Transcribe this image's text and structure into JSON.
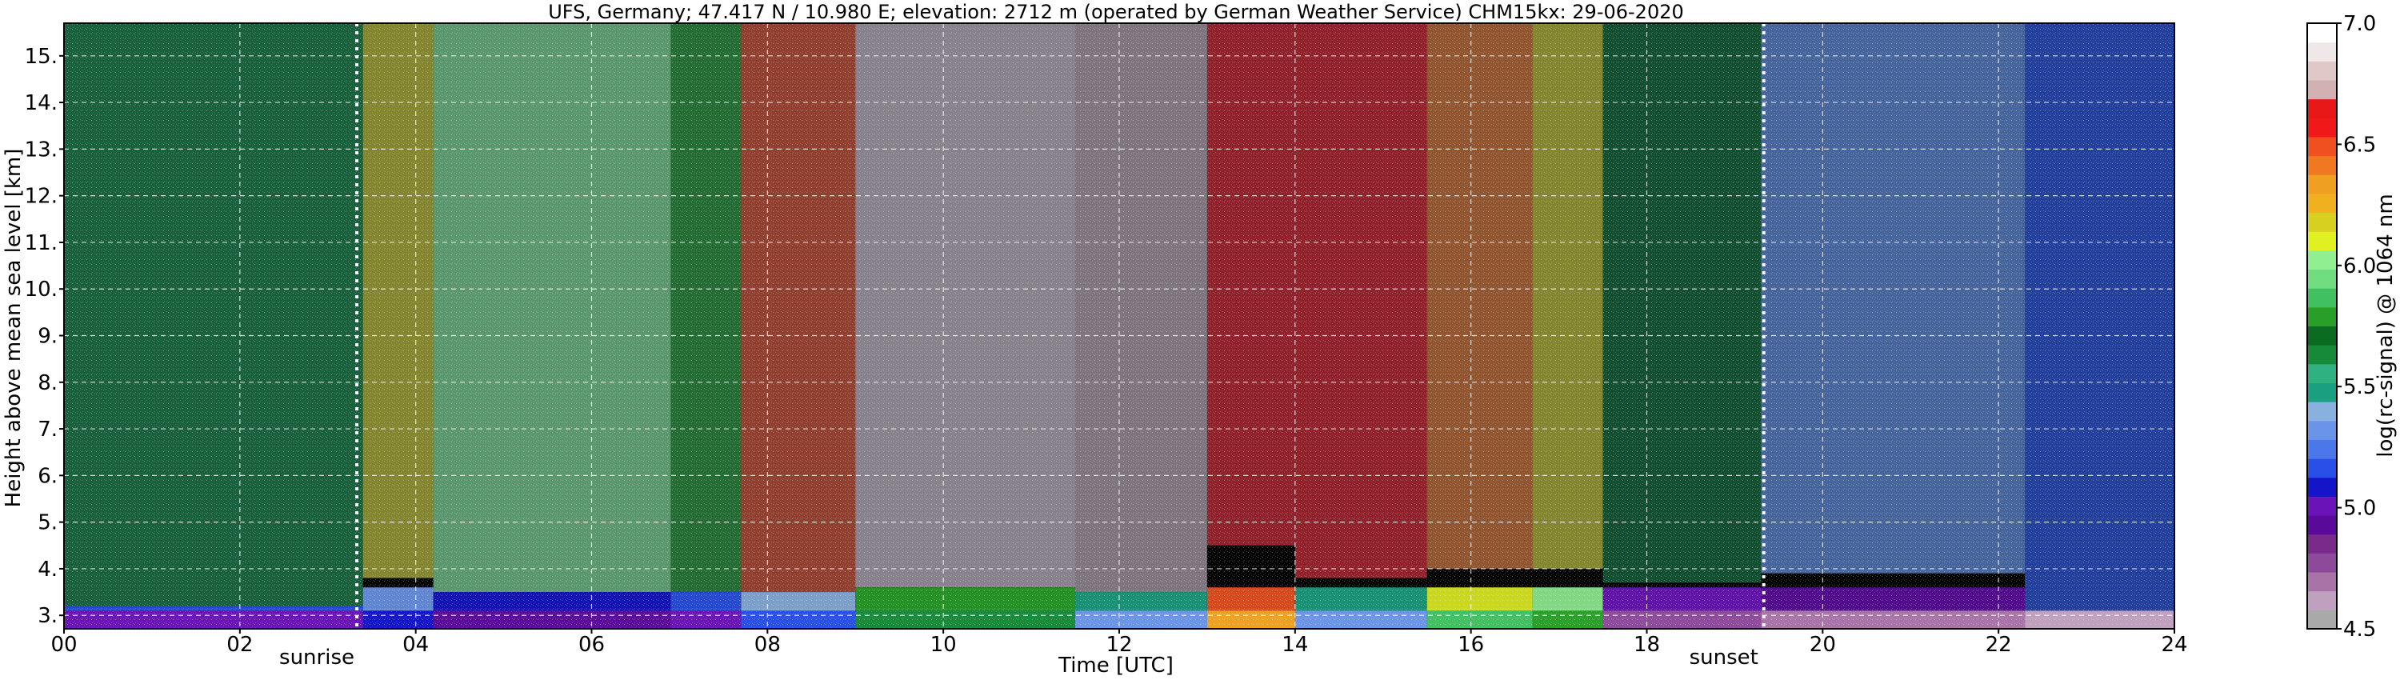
{
  "chart_data": {
    "type": "heatmap",
    "title": "UFS, Germany; 47.417 N / 10.980 E; elevation: 2712 m  (operated by German Weather Service)    CHM15kx: 29-06-2020",
    "xlabel": "Time [UTC]",
    "ylabel": "Height above mean sea level [km]",
    "xlim": [
      0,
      24
    ],
    "ylim": [
      2.712,
      15.7
    ],
    "x_ticks": [
      0,
      2,
      4,
      6,
      8,
      10,
      12,
      14,
      16,
      18,
      20,
      22,
      24
    ],
    "x_tick_labels": [
      "00",
      "02",
      "04",
      "06",
      "08",
      "10",
      "12",
      "14",
      "16",
      "18",
      "20",
      "22",
      "24"
    ],
    "y_ticks": [
      3,
      4,
      5,
      6,
      7,
      8,
      9,
      10,
      11,
      12,
      13,
      14,
      15
    ],
    "y_tick_labels": [
      "3.",
      "4.",
      "5.",
      "6.",
      "7.",
      "8.",
      "9.",
      "10.",
      "11.",
      "12.",
      "13.",
      "14.",
      "15."
    ],
    "grid": true,
    "events": [
      {
        "label": "sunrise",
        "time": 3.33
      },
      {
        "label": "sunset",
        "time": 19.33
      }
    ],
    "colorbar": {
      "label": "log(rc-signal) @ 1064 nm",
      "range": [
        4.5,
        7.0
      ],
      "ticks": [
        4.5,
        5.0,
        5.5,
        6.0,
        6.5,
        7.0
      ],
      "tick_labels": [
        "4.5",
        "5.0",
        "5.5",
        "6.0",
        "6.5",
        "7.0"
      ],
      "colors": [
        "#a9a9a9",
        "#bfa0bf",
        "#a874a8",
        "#8e4a9a",
        "#7a2a8a",
        "#5a0a9a",
        "#6a14b8",
        "#1414c8",
        "#2850e8",
        "#4a78ea",
        "#6a94e8",
        "#8ab0e0",
        "#1aa080",
        "#30b080",
        "#168a38",
        "#0a6a20",
        "#28a028",
        "#40c060",
        "#70dc80",
        "#90f090",
        "#e0f020",
        "#d8d020",
        "#f0b020",
        "#f0a020",
        "#f07820",
        "#f05020",
        "#f01818",
        "#e81818",
        "#d0b0b0",
        "#e0c8c8",
        "#f0e8e8",
        "#ffffff"
      ]
    },
    "backscatter": {
      "note_colors": {
        "noise_day": "#c8a890",
        "noise_night": "#3a2a5a",
        "background": "#000000"
      },
      "segments": [
        {
          "t0": 0.0,
          "t1": 3.4,
          "sky": 5.6,
          "layer_top": 3.2,
          "layer_value": 5.2
        },
        {
          "t0": 3.4,
          "t1": 4.2,
          "sky": 6.2,
          "layer_top": 3.8,
          "layer_value": 5.3
        },
        {
          "t0": 4.2,
          "t1": 6.9,
          "sky": 6.0,
          "layer_top": 3.5,
          "layer_value": 5.1
        },
        {
          "t0": 6.9,
          "t1": 7.7,
          "sky": 5.8,
          "layer_top": 3.5,
          "layer_value": 5.2
        },
        {
          "t0": 7.7,
          "t1": 9.0,
          "sky": 6.5,
          "layer_top": 3.5,
          "layer_value": 5.4
        },
        {
          "t0": 9.0,
          "t1": 11.5,
          "sky": 6.8,
          "layer_top": 3.6,
          "layer_value": 5.8
        },
        {
          "t0": 11.5,
          "t1": 13.0,
          "sky": 6.7,
          "layer_top": 3.5,
          "layer_value": 5.5
        },
        {
          "t0": 13.0,
          "t1": 14.0,
          "sky": 6.6,
          "layer_top": 4.5,
          "layer_value": 6.5
        },
        {
          "t0": 14.0,
          "t1": 15.5,
          "sky": 6.6,
          "layer_top": 3.8,
          "layer_value": 5.5
        },
        {
          "t0": 15.5,
          "t1": 16.7,
          "sky": 6.4,
          "layer_top": 4.0,
          "layer_value": 6.1
        },
        {
          "t0": 16.7,
          "t1": 17.5,
          "sky": 6.2,
          "layer_top": 4.0,
          "layer_value": 6.0
        },
        {
          "t0": 17.5,
          "t1": 19.3,
          "sky": 5.7,
          "layer_top": 3.7,
          "layer_value": 5.0
        },
        {
          "t0": 19.3,
          "t1": 22.3,
          "sky": 5.3,
          "layer_top": 3.9,
          "layer_value": 4.9
        },
        {
          "t0": 22.3,
          "t1": 24.0,
          "sky": 5.2,
          "layer_top": 3.1,
          "layer_value": 4.8
        }
      ]
    }
  }
}
